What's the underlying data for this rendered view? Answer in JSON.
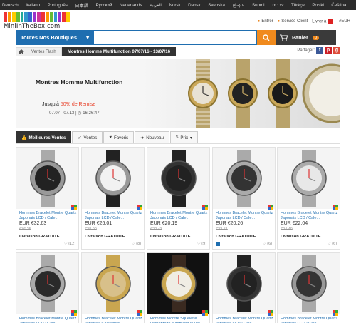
{
  "languages": [
    "Deutsch",
    "Italiano",
    "Português",
    "日本語",
    "Pусский",
    "Nederlands",
    "العربية",
    "Norsk",
    "Dansk",
    "Svenska",
    "한국어",
    "Suomi",
    "עברית",
    "Türkçe",
    "Polski",
    "Čeština"
  ],
  "header": {
    "logo_text": "MiniInTheBox.com",
    "sign_in": "Entrer",
    "service": "Service Client",
    "deliver": "Livrer à",
    "currency": "#EUR"
  },
  "nav": {
    "categories_label": "Toutes Nos Boutiques",
    "search_placeholder": "",
    "cart_label": "Panier",
    "cart_count": "0"
  },
  "breadcrumb": {
    "item1": "Ventes Flash",
    "current": "Montres Homme Multifunction 07/07/16 - 13/07/16"
  },
  "share": {
    "label": "Partager:"
  },
  "banner": {
    "title": "Montres Homme Multifunction",
    "discount_prefix": "Jusqu'à",
    "discount_value": "50% de Remise",
    "dates": "07.07 - 07.13",
    "time": "16:26:47"
  },
  "tabs": [
    {
      "label": "Meilleures Ventes",
      "icon": "thumbs-up-icon"
    },
    {
      "label": "Ventes",
      "icon": "check-circle-icon"
    },
    {
      "label": "Favoris",
      "icon": "heart-icon"
    },
    {
      "label": "Nouveau",
      "icon": "arrow-circle-icon"
    },
    {
      "label": "Prix",
      "icon": "dollar-icon"
    }
  ],
  "products": [
    {
      "title": "Hommes Bracelet Montre Quartz Japonais LCD / Cale...",
      "price": "EUR €32.63",
      "old_price": "€36.25",
      "shipping": "Livraison GRATUITE",
      "favs": "(12)"
    },
    {
      "title": "Hommes Bracelet Montre Quartz Japonais LCD / Cale...",
      "price": "EUR €26.01",
      "old_price": "€28.90",
      "shipping": "Livraison GRATUITE",
      "favs": "(8)"
    },
    {
      "title": "Hommes Bracelet Montre Quartz Japonais LCD / Cale...",
      "price": "EUR €20.19",
      "old_price": "€22.43",
      "shipping": "Livraison GRATUITE",
      "favs": "(9)"
    },
    {
      "title": "Hommes Bracelet Montre Quartz Japonais LCD / Cale...",
      "price": "EUR €20.26",
      "old_price": "€22.51",
      "shipping": "Livraison GRATUITE",
      "favs": "(6)"
    },
    {
      "title": "Hommes Bracelet Montre Quartz Japonais LCD / Cale...",
      "price": "EUR €22.04",
      "old_price": "€24.49",
      "shipping": "Livraison GRATUITE",
      "favs": "(6)"
    },
    {
      "title": "Hommes Bracelet Montre Quartz Japonais LCD / Cale..."
    },
    {
      "title": "Hommes Bracelet Montre Quartz Japonais Calendrier..."
    },
    {
      "title": "Hommes Montre Squelette Remontage automatique Ver..."
    },
    {
      "title": "Hommes Bracelet Montre Quartz Japonais LCD / Cale..."
    },
    {
      "title": "Hommes Bracelet Montre Quartz Japonais LCD / Cale..."
    }
  ],
  "colors": {
    "brand_blue": "#1f6eb0",
    "accent_orange": "#f08a1d",
    "dark": "#333333",
    "discount_red": "#e8432c"
  }
}
